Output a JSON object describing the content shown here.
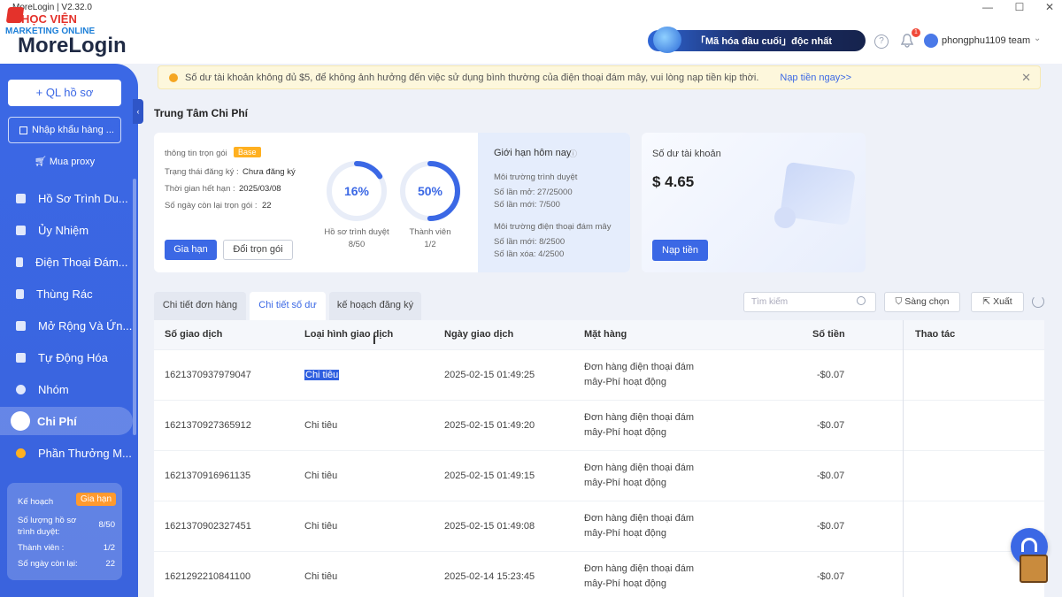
{
  "window": {
    "title": "MoreLogin | V2.32.0",
    "controls": [
      "minimize-icon",
      "maximize-icon",
      "close-icon"
    ]
  },
  "watermark": {
    "line1": "HỌC VIỆN",
    "line2": "MARKETING ONLINE"
  },
  "header": {
    "logo": "MoreLogin",
    "promo": "「Mã hóa đầu cuối」độc nhất",
    "notification_count": "1",
    "user": "phongphu1109 team"
  },
  "sidebar": {
    "add_profile": "+ QL hồ sơ",
    "import": "Nhập khẩu hàng ...",
    "buy_proxy": "Mua proxy",
    "items": [
      {
        "label": "Hồ Sơ Trình Du...",
        "icon": "browser-icon"
      },
      {
        "label": "Ủy Nhiệm",
        "icon": "proxy-icon"
      },
      {
        "label": "Điện Thoại Đám...",
        "icon": "phone-icon"
      },
      {
        "label": "Thùng Rác",
        "icon": "trash-icon"
      },
      {
        "label": "Mở Rộng Và Ứn...",
        "icon": "puzzle-icon"
      },
      {
        "label": "Tự Động Hóa",
        "icon": "robot-icon"
      },
      {
        "label": "Nhóm",
        "icon": "group-icon"
      },
      {
        "label": "Chi Phí",
        "icon": "cost-icon"
      },
      {
        "label": "Phần Thưởng M...",
        "icon": "reward-icon"
      }
    ],
    "active_index": 7,
    "plan": {
      "title": "Kế hoạch",
      "renew": "Gia hạn",
      "profiles_label": "Số lượng hồ sơ trình duyệt:",
      "profiles_value": "8/50",
      "members_label": "Thành viên :",
      "members_value": "1/2",
      "days_label": "Số ngày còn lại:",
      "days_value": "22"
    }
  },
  "notice": {
    "text": "Số dư tài khoản không đủ $5, để không ảnh hưởng đến việc sử dụng bình thường của điện thoại đám mây, vui lòng nạp tiền kịp thời.",
    "link": "Nạp tiền ngay>>"
  },
  "page_title": "Trung Tâm Chi Phí",
  "package": {
    "info_label": "thông tin trọn gói",
    "badge": "Base",
    "status_label": "Trạng thái đăng ký :",
    "status_value": "Chưa đăng ký",
    "expiry_label": "Thời gian hết hạn :",
    "expiry_value": "2025/03/08",
    "days_label": "Số ngày còn lại trọn gói :",
    "days_value": "22",
    "renew_btn": "Gia hạn",
    "change_btn": "Đổi trọn gói",
    "gauges": [
      {
        "value": "16%",
        "fraction": 0.16,
        "caption": "Hồ sơ trình duyệt",
        "sub": "8/50"
      },
      {
        "value": "50%",
        "fraction": 0.5,
        "caption": "Thành viên",
        "sub": "1/2"
      }
    ]
  },
  "limits": {
    "title": "Giới hạn hôm nay",
    "browser_env": "Môi trường trình duyệt",
    "browser_open": "Số lần mở: 27/25000",
    "browser_new": "Số lần mới: 7/500",
    "cloud_env": "Môi trường điện thoại đám mây",
    "cloud_new": "Số lần mới: 8/2500",
    "cloud_delete": "Số lần xóa: 4/2500"
  },
  "balance": {
    "label": "Số dư tài khoản",
    "amount": "$ 4.65",
    "topup": "Nạp tiền"
  },
  "tabs": [
    {
      "label": "Chi tiết đơn hàng"
    },
    {
      "label": "Chi tiết số dư"
    },
    {
      "label": "kế hoạch đăng ký"
    }
  ],
  "active_tab": 1,
  "toolbar": {
    "search_placeholder": "Tìm kiếm",
    "filter": "Sàng chọn",
    "export": "Xuất"
  },
  "table": {
    "columns": [
      "Số giao dịch",
      "Loại hình giao dịch",
      "Ngày giao dịch",
      "Mặt hàng",
      "Số tiền",
      "Thao tác"
    ],
    "rows": [
      {
        "id": "1621370937979047",
        "type": "Chi tiêu",
        "date": "2025-02-15 01:49:25",
        "item": "Đơn hàng điện thoại đám mây-Phí hoạt động",
        "amount": "-$0.07"
      },
      {
        "id": "1621370927365912",
        "type": "Chi tiêu",
        "date": "2025-02-15 01:49:20",
        "item": "Đơn hàng điện thoại đám mây-Phí hoạt động",
        "amount": "-$0.07"
      },
      {
        "id": "1621370916961135",
        "type": "Chi tiêu",
        "date": "2025-02-15 01:49:15",
        "item": "Đơn hàng điện thoại đám mây-Phí hoạt động",
        "amount": "-$0.07"
      },
      {
        "id": "1621370902327451",
        "type": "Chi tiêu",
        "date": "2025-02-15 01:49:08",
        "item": "Đơn hàng điện thoại đám mây-Phí hoạt động",
        "amount": "-$0.07"
      },
      {
        "id": "1621292210841100",
        "type": "Chi tiêu",
        "date": "2025-02-14 15:23:45",
        "item": "Đơn hàng điện thoại đám mây-Phí hoạt động",
        "amount": "-$0.07"
      }
    ]
  },
  "colors": {
    "primary": "#3b68e5",
    "warning": "#ffb020",
    "sidebar": "#3b68e5"
  }
}
